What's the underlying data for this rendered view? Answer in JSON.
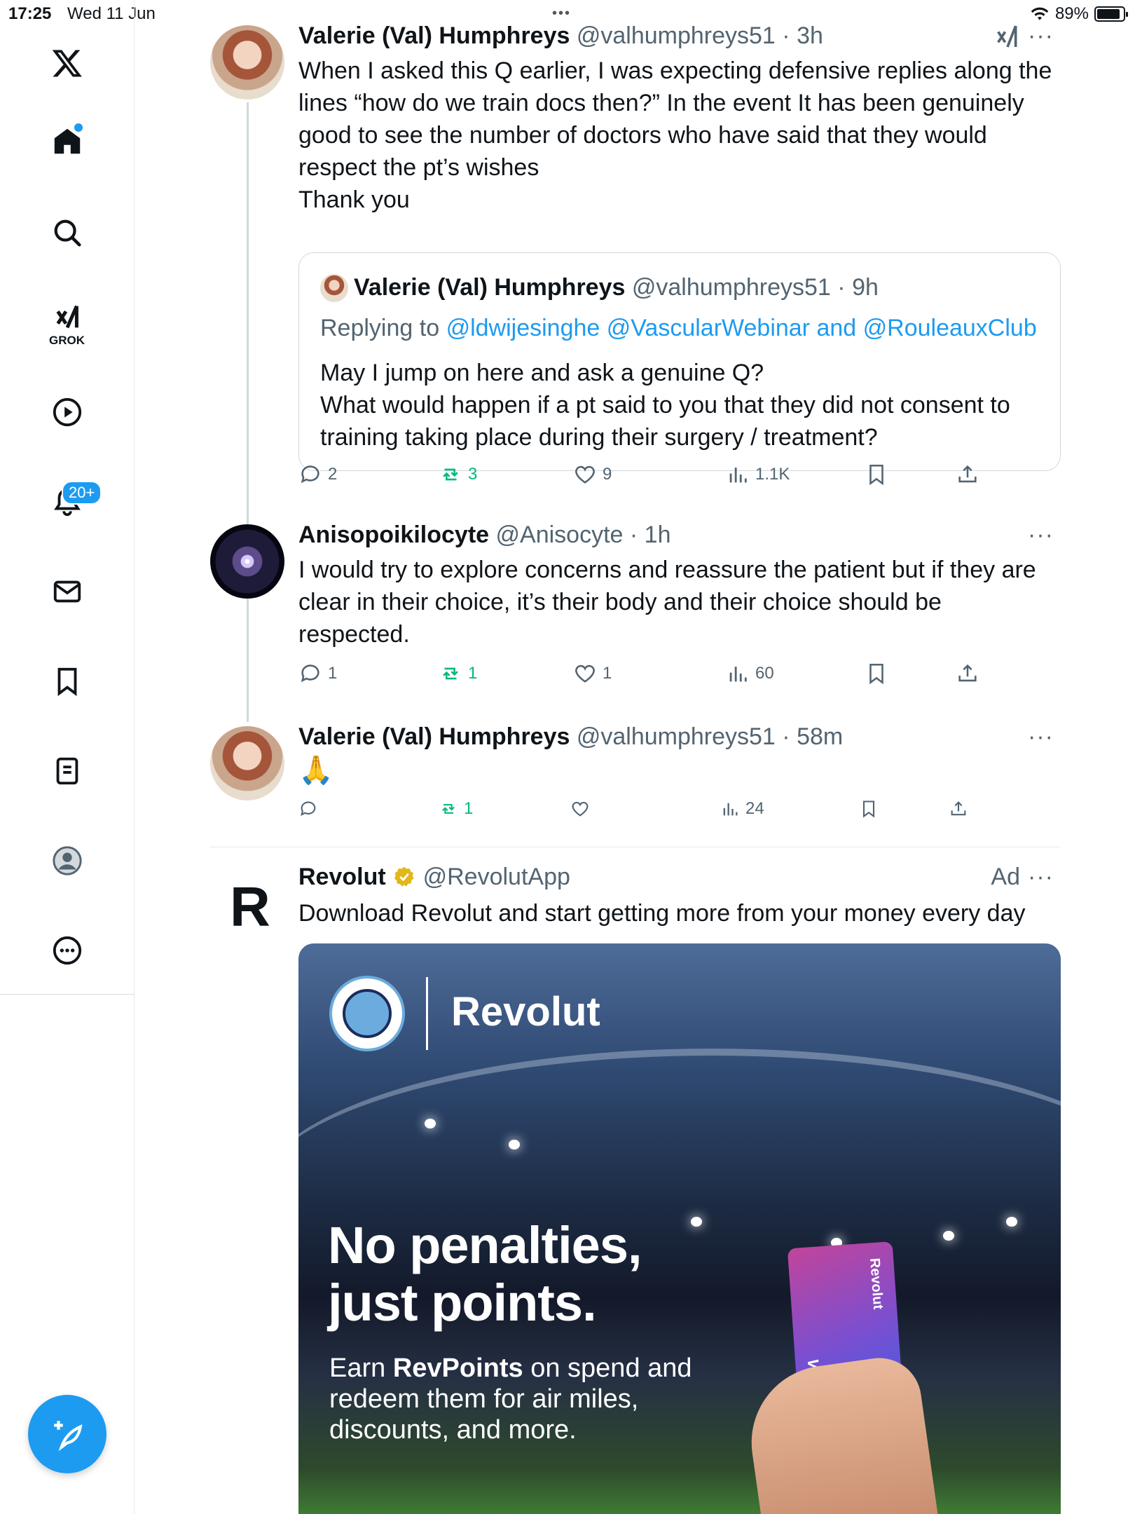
{
  "status_bar": {
    "time": "17:25",
    "date": "Wed 11 Jun",
    "battery": "89%"
  },
  "sidebar": {
    "items": [
      {
        "name": "home",
        "label": "Home"
      },
      {
        "name": "search",
        "label": "Search"
      },
      {
        "name": "grok",
        "label": "GROK"
      },
      {
        "name": "video",
        "label": "Video"
      },
      {
        "name": "notifications",
        "label": "Notifications",
        "badge": "20+"
      },
      {
        "name": "messages",
        "label": "Messages"
      },
      {
        "name": "bookmarks",
        "label": "Bookmarks"
      },
      {
        "name": "lists",
        "label": "Lists"
      },
      {
        "name": "profile",
        "label": "Profile"
      },
      {
        "name": "more",
        "label": "More"
      }
    ]
  },
  "posts": [
    {
      "name": "Valerie (Val) Humphreys",
      "handle": "@valhumphreys51",
      "time": "3h",
      "text": "When I asked this Q earlier, I was expecting defensive replies along the lines “how do we train docs then?” In the event It has been genuinely good to see the number of doctors who have said that they would respect the pt’s wishes\nThank you",
      "quote": {
        "name": "Valerie (Val) Humphreys",
        "handle": "@valhumphreys51",
        "time": "9h",
        "replying_prefix": "Replying to",
        "replying_to": "@ldwijesinghe @VascularWebinar and @RouleauxClub",
        "text": "May I jump on here and ask a genuine Q?\nWhat would happen if a pt said to you that they did not consent to training taking place during their surgery / treatment?"
      },
      "stats": {
        "replies": "2",
        "reposts": "3",
        "likes": "9",
        "views": "1.1K"
      }
    },
    {
      "name": "Anisopoikilocyte",
      "handle": "@Anisocyte",
      "time": "1h",
      "text": "I would try to explore concerns and reassure the patient but if they are clear in their choice, it’s their body and their choice should be respected.",
      "stats": {
        "replies": "1",
        "reposts": "1",
        "likes": "1",
        "views": "60"
      }
    },
    {
      "name": "Valerie (Val) Humphreys",
      "handle": "@valhumphreys51",
      "time": "58m",
      "text": "🙏",
      "stats": {
        "reposts": "1",
        "views": "24"
      }
    }
  ],
  "ad": {
    "name": "Revolut",
    "handle": "@RevolutApp",
    "ad_label": "Ad",
    "text": "Download Revolut and start getting more from your money every day",
    "logo_letter": "R",
    "media": {
      "brand": "Revolut",
      "headline": "No penalties,\njust points.",
      "sub_pre": "Earn ",
      "sub_bold": "RevPoints",
      "sub_post": " on spend and redeem them for air miles, discounts, and more.",
      "card_brand": "Revolut",
      "card_network": "VISA"
    }
  },
  "colors": {
    "accent": "#1d9bf0",
    "repost": "#00ba7c",
    "muted": "#536471"
  }
}
